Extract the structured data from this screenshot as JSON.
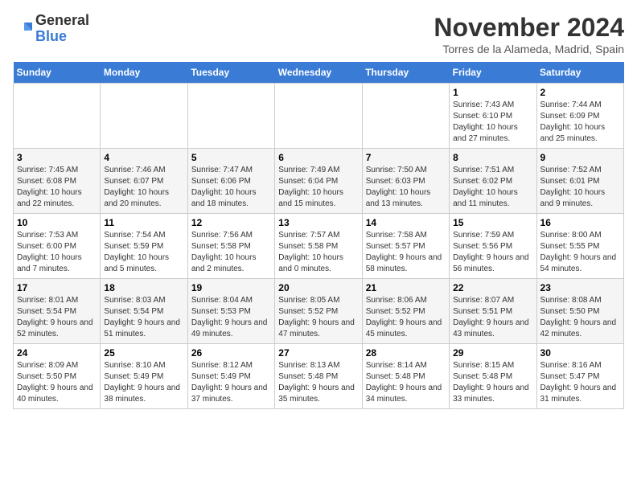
{
  "header": {
    "logo_line1": "General",
    "logo_line2": "Blue",
    "month": "November 2024",
    "location": "Torres de la Alameda, Madrid, Spain"
  },
  "weekdays": [
    "Sunday",
    "Monday",
    "Tuesday",
    "Wednesday",
    "Thursday",
    "Friday",
    "Saturday"
  ],
  "weeks": [
    [
      {
        "day": "",
        "info": ""
      },
      {
        "day": "",
        "info": ""
      },
      {
        "day": "",
        "info": ""
      },
      {
        "day": "",
        "info": ""
      },
      {
        "day": "",
        "info": ""
      },
      {
        "day": "1",
        "info": "Sunrise: 7:43 AM\nSunset: 6:10 PM\nDaylight: 10 hours and 27 minutes."
      },
      {
        "day": "2",
        "info": "Sunrise: 7:44 AM\nSunset: 6:09 PM\nDaylight: 10 hours and 25 minutes."
      }
    ],
    [
      {
        "day": "3",
        "info": "Sunrise: 7:45 AM\nSunset: 6:08 PM\nDaylight: 10 hours and 22 minutes."
      },
      {
        "day": "4",
        "info": "Sunrise: 7:46 AM\nSunset: 6:07 PM\nDaylight: 10 hours and 20 minutes."
      },
      {
        "day": "5",
        "info": "Sunrise: 7:47 AM\nSunset: 6:06 PM\nDaylight: 10 hours and 18 minutes."
      },
      {
        "day": "6",
        "info": "Sunrise: 7:49 AM\nSunset: 6:04 PM\nDaylight: 10 hours and 15 minutes."
      },
      {
        "day": "7",
        "info": "Sunrise: 7:50 AM\nSunset: 6:03 PM\nDaylight: 10 hours and 13 minutes."
      },
      {
        "day": "8",
        "info": "Sunrise: 7:51 AM\nSunset: 6:02 PM\nDaylight: 10 hours and 11 minutes."
      },
      {
        "day": "9",
        "info": "Sunrise: 7:52 AM\nSunset: 6:01 PM\nDaylight: 10 hours and 9 minutes."
      }
    ],
    [
      {
        "day": "10",
        "info": "Sunrise: 7:53 AM\nSunset: 6:00 PM\nDaylight: 10 hours and 7 minutes."
      },
      {
        "day": "11",
        "info": "Sunrise: 7:54 AM\nSunset: 5:59 PM\nDaylight: 10 hours and 5 minutes."
      },
      {
        "day": "12",
        "info": "Sunrise: 7:56 AM\nSunset: 5:58 PM\nDaylight: 10 hours and 2 minutes."
      },
      {
        "day": "13",
        "info": "Sunrise: 7:57 AM\nSunset: 5:58 PM\nDaylight: 10 hours and 0 minutes."
      },
      {
        "day": "14",
        "info": "Sunrise: 7:58 AM\nSunset: 5:57 PM\nDaylight: 9 hours and 58 minutes."
      },
      {
        "day": "15",
        "info": "Sunrise: 7:59 AM\nSunset: 5:56 PM\nDaylight: 9 hours and 56 minutes."
      },
      {
        "day": "16",
        "info": "Sunrise: 8:00 AM\nSunset: 5:55 PM\nDaylight: 9 hours and 54 minutes."
      }
    ],
    [
      {
        "day": "17",
        "info": "Sunrise: 8:01 AM\nSunset: 5:54 PM\nDaylight: 9 hours and 52 minutes."
      },
      {
        "day": "18",
        "info": "Sunrise: 8:03 AM\nSunset: 5:54 PM\nDaylight: 9 hours and 51 minutes."
      },
      {
        "day": "19",
        "info": "Sunrise: 8:04 AM\nSunset: 5:53 PM\nDaylight: 9 hours and 49 minutes."
      },
      {
        "day": "20",
        "info": "Sunrise: 8:05 AM\nSunset: 5:52 PM\nDaylight: 9 hours and 47 minutes."
      },
      {
        "day": "21",
        "info": "Sunrise: 8:06 AM\nSunset: 5:52 PM\nDaylight: 9 hours and 45 minutes."
      },
      {
        "day": "22",
        "info": "Sunrise: 8:07 AM\nSunset: 5:51 PM\nDaylight: 9 hours and 43 minutes."
      },
      {
        "day": "23",
        "info": "Sunrise: 8:08 AM\nSunset: 5:50 PM\nDaylight: 9 hours and 42 minutes."
      }
    ],
    [
      {
        "day": "24",
        "info": "Sunrise: 8:09 AM\nSunset: 5:50 PM\nDaylight: 9 hours and 40 minutes."
      },
      {
        "day": "25",
        "info": "Sunrise: 8:10 AM\nSunset: 5:49 PM\nDaylight: 9 hours and 38 minutes."
      },
      {
        "day": "26",
        "info": "Sunrise: 8:12 AM\nSunset: 5:49 PM\nDaylight: 9 hours and 37 minutes."
      },
      {
        "day": "27",
        "info": "Sunrise: 8:13 AM\nSunset: 5:48 PM\nDaylight: 9 hours and 35 minutes."
      },
      {
        "day": "28",
        "info": "Sunrise: 8:14 AM\nSunset: 5:48 PM\nDaylight: 9 hours and 34 minutes."
      },
      {
        "day": "29",
        "info": "Sunrise: 8:15 AM\nSunset: 5:48 PM\nDaylight: 9 hours and 33 minutes."
      },
      {
        "day": "30",
        "info": "Sunrise: 8:16 AM\nSunset: 5:47 PM\nDaylight: 9 hours and 31 minutes."
      }
    ]
  ]
}
